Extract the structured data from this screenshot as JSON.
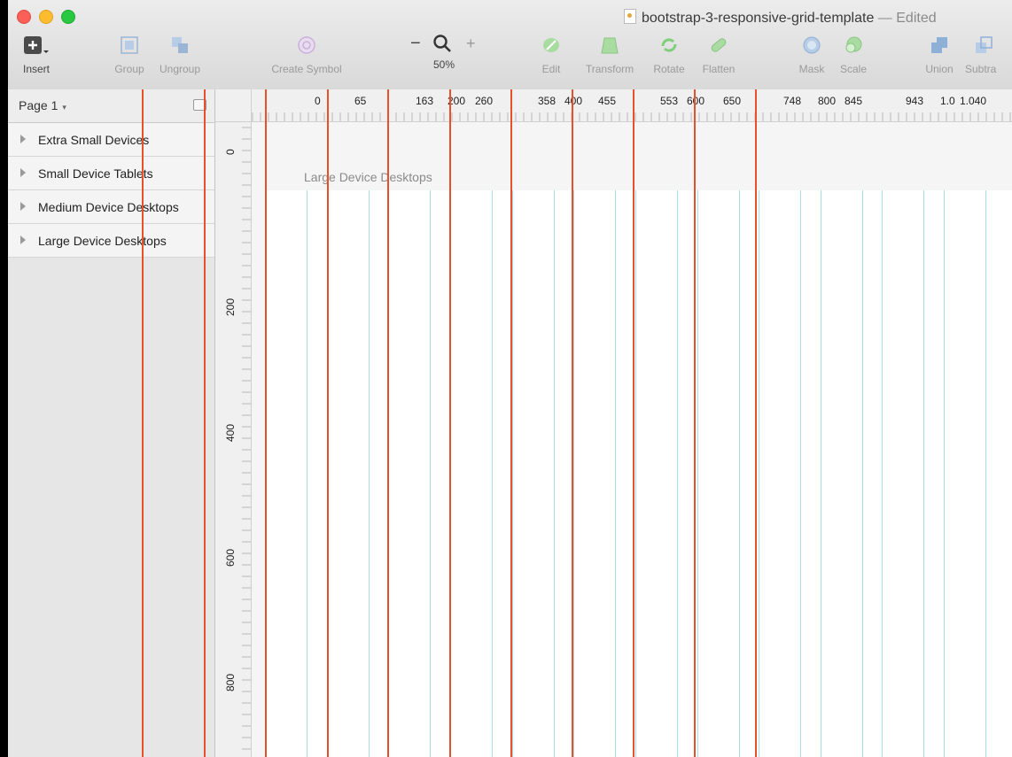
{
  "window": {
    "title": "bootstrap-3-responsive-grid-template",
    "title_separator": "—",
    "status": "Edited"
  },
  "toolbar": {
    "insert": "Insert",
    "group": "Group",
    "ungroup": "Ungroup",
    "create_symbol": "Create Symbol",
    "zoom_minus": "−",
    "zoom_plus": "+",
    "zoom_level": "50%",
    "edit": "Edit",
    "transform": "Transform",
    "rotate": "Rotate",
    "flatten": "Flatten",
    "mask": "Mask",
    "scale": "Scale",
    "union": "Union",
    "subtract": "Subtra"
  },
  "sidebar": {
    "page_name": "Page 1",
    "caret": "▾",
    "layers": [
      {
        "label": "Extra Small Devices"
      },
      {
        "label": "Small Device Tablets"
      },
      {
        "label": "Medium Device Desktops"
      },
      {
        "label": "Large Device Desktops"
      }
    ]
  },
  "canvas": {
    "artboard_title": "Large Device Desktops",
    "hruler_labels": [
      "0",
      "65",
      "163",
      "200",
      "260",
      "358",
      "400",
      "455",
      "553",
      "600",
      "650",
      "748",
      "800",
      "845",
      "943",
      "1.0",
      "1.040"
    ],
    "vruler_labels": [
      "0",
      "200",
      "400",
      "600",
      "800"
    ]
  },
  "colors": {
    "guide": "#e8502c",
    "column_border": "#a8dde6",
    "accent_green": "#6cc26a"
  }
}
